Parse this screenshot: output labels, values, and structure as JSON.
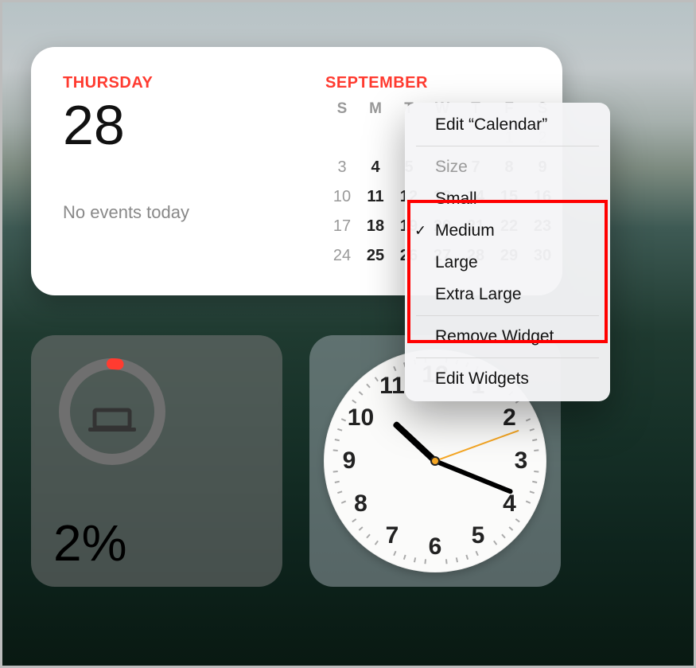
{
  "calendar": {
    "day_label": "THURSDAY",
    "day_number": "28",
    "no_events": "No events today",
    "month_label": "SEPTEMBER",
    "dow": [
      "S",
      "M",
      "T",
      "W",
      "T",
      "F",
      "S"
    ],
    "rows": [
      {
        "cells": [
          "",
          "",
          "",
          "",
          "",
          "1",
          "2"
        ],
        "dim": [
          false,
          false,
          false,
          false,
          false,
          true,
          true
        ]
      },
      {
        "cells": [
          "3",
          "4",
          "5",
          "6",
          "7",
          "8",
          "9"
        ],
        "bold_from": 1
      },
      {
        "cells": [
          "10",
          "11",
          "12",
          "13",
          "14",
          "15",
          "16"
        ],
        "bold_from": 1
      },
      {
        "cells": [
          "17",
          "18",
          "19",
          "20",
          "21",
          "22",
          "23"
        ],
        "bold_from": 1
      },
      {
        "cells": [
          "24",
          "25",
          "26",
          "27",
          "28",
          "29",
          "30"
        ],
        "bold_from": 1
      }
    ]
  },
  "battery": {
    "percent_label": "2%",
    "percent_value": 2,
    "fill_color": "#ff3b30",
    "track_color": "#6f6f6f"
  },
  "clock": {
    "numbers": [
      "12",
      "1",
      "2",
      "3",
      "4",
      "5",
      "6",
      "7",
      "8",
      "9",
      "10",
      "11"
    ],
    "hour_angle": 313,
    "minute_angle": 112,
    "second_angle": 70
  },
  "context_menu": {
    "edit_label": "Edit “Calendar”",
    "size_header": "Size",
    "sizes": [
      {
        "label": "Small",
        "checked": false
      },
      {
        "label": "Medium",
        "checked": true
      },
      {
        "label": "Large",
        "checked": false
      },
      {
        "label": "Extra Large",
        "checked": false
      }
    ],
    "remove_label": "Remove Widget",
    "edit_widgets_label": "Edit Widgets"
  },
  "colors": {
    "accent_red": "#ff3b30",
    "highlight_red": "#ff0000",
    "second_hand": "#f5a623"
  }
}
